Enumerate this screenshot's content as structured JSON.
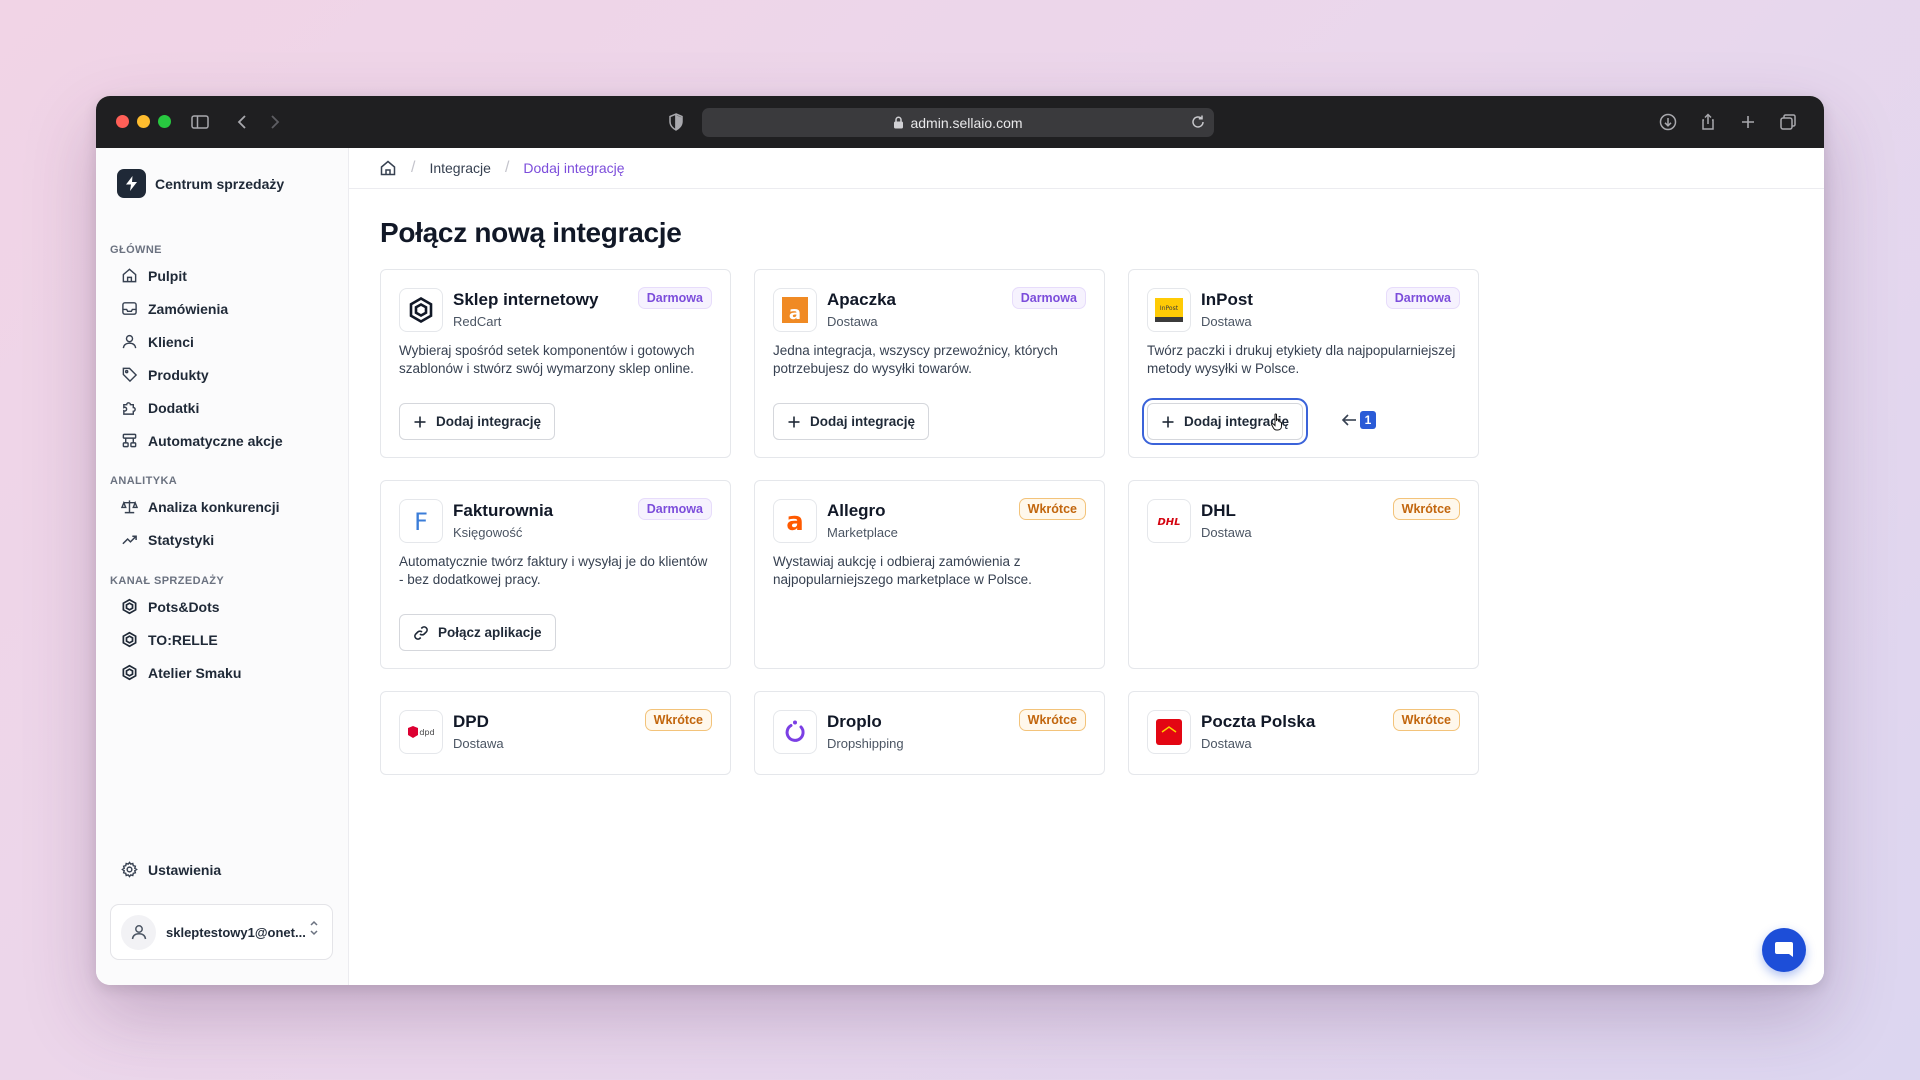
{
  "browser": {
    "url": "admin.sellaio.com"
  },
  "sidebar": {
    "brand": "Centrum sprzedaży",
    "sections": [
      {
        "heading": "GŁÓWNE",
        "items": [
          "Pulpit",
          "Zamówienia",
          "Klienci",
          "Produkty",
          "Dodatki",
          "Automatyczne akcje"
        ]
      },
      {
        "heading": "ANALITYKA",
        "items": [
          "Analiza konkurencji",
          "Statystyki"
        ]
      },
      {
        "heading": "KANAŁ SPRZEDAŻY",
        "items": [
          "Pots&Dots",
          "TO:RELLE",
          "Atelier Smaku"
        ]
      }
    ],
    "settings": "Ustawienia",
    "account_email": "skleptestowy1@onet..."
  },
  "breadcrumb": {
    "items": [
      "Integracje",
      "Dodaj integrację"
    ]
  },
  "page_title": "Połącz nową integracje",
  "cards": [
    {
      "title": "Sklep internetowy",
      "subtitle": "RedCart",
      "badge": "Darmowa",
      "badge_type": "free",
      "logo": "redcart-logo-icon",
      "description": "Wybieraj spośród setek komponentów i gotowych szablonów i stwórz swój wymarzony sklep online.",
      "button": "Dodaj integrację",
      "button_icon": "plus-icon"
    },
    {
      "title": "Apaczka",
      "subtitle": "Dostawa",
      "badge": "Darmowa",
      "badge_type": "free",
      "logo": "apaczka-logo-icon",
      "description": "Jedna integracja, wszyscy przewoźnicy, których potrzebujesz do wysyłki towarów.",
      "button": "Dodaj integrację",
      "button_icon": "plus-icon"
    },
    {
      "title": "InPost",
      "subtitle": "Dostawa",
      "badge": "Darmowa",
      "badge_type": "free",
      "logo": "inpost-logo-icon",
      "description": "Twórz paczki i drukuj etykiety dla najpopularniejszej metody wysyłki w Polsce.",
      "button": "Dodaj integrację",
      "button_icon": "plus-icon",
      "hint_number": "1"
    },
    {
      "title": "Fakturownia",
      "subtitle": "Księgowość",
      "badge": "Darmowa",
      "badge_type": "free",
      "logo": "fakturownia-logo-icon",
      "description": "Automatycznie twórz faktury i wysyłaj je do klientów - bez dodatkowej pracy.",
      "button": "Połącz aplikacje",
      "button_icon": "link-icon"
    },
    {
      "title": "Allegro",
      "subtitle": "Marketplace",
      "badge": "Wkrótce",
      "badge_type": "soon",
      "logo": "allegro-logo-icon",
      "description": "Wystawiaj aukcję i odbieraj zamówienia z najpopularniejszego marketplace w Polsce."
    },
    {
      "title": "DHL",
      "subtitle": "Dostawa",
      "badge": "Wkrótce",
      "badge_type": "soon",
      "logo": "dhl-logo-icon"
    },
    {
      "title": "DPD",
      "subtitle": "Dostawa",
      "badge": "Wkrótce",
      "badge_type": "soon",
      "logo": "dpd-logo-icon"
    },
    {
      "title": "Droplo",
      "subtitle": "Dropshipping",
      "badge": "Wkrótce",
      "badge_type": "soon",
      "logo": "droplo-logo-icon"
    },
    {
      "title": "Poczta Polska",
      "subtitle": "Dostawa",
      "badge": "Wkrótce",
      "badge_type": "soon",
      "logo": "poczta-polska-logo-icon"
    }
  ],
  "colors": {
    "accent": "#7c4ddb",
    "soon": "#c2660d",
    "chat": "#1d4ed8"
  }
}
